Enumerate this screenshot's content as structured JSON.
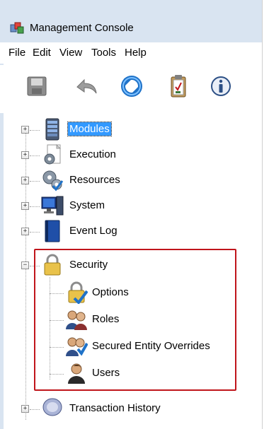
{
  "window": {
    "title": "Management Console"
  },
  "menu": [
    "File",
    "Edit",
    "View",
    "Tools",
    "Help"
  ],
  "toolbar": [
    {
      "icon": "save-icon"
    },
    {
      "icon": "undo-icon"
    },
    {
      "icon": "refresh-icon"
    },
    {
      "icon": "clipboard-icon"
    },
    {
      "icon": "info-icon"
    }
  ],
  "tree": {
    "nodes": [
      {
        "label": "Modules",
        "icon": "server-icon",
        "selected": true
      },
      {
        "label": "Execution",
        "icon": "gear-icon"
      },
      {
        "label": "Resources",
        "icon": "gears-check-icon"
      },
      {
        "label": "System",
        "icon": "computer-icon"
      },
      {
        "label": "Event Log",
        "icon": "book-icon"
      },
      {
        "label": "Security",
        "icon": "padlock-icon",
        "expanded": true,
        "children": [
          {
            "label": "Options",
            "icon": "padlock-check-icon"
          },
          {
            "label": "Roles",
            "icon": "people-icon"
          },
          {
            "label": "Secured Entity Overrides",
            "icon": "people-check-icon"
          },
          {
            "label": "Users",
            "icon": "user-icon"
          }
        ]
      },
      {
        "label": "Transaction History",
        "icon": "history-icon"
      }
    ]
  },
  "colors": {
    "selection": "#3399ff",
    "highlight_border": "#c0151b",
    "titlebar": "#d9e4f1"
  }
}
